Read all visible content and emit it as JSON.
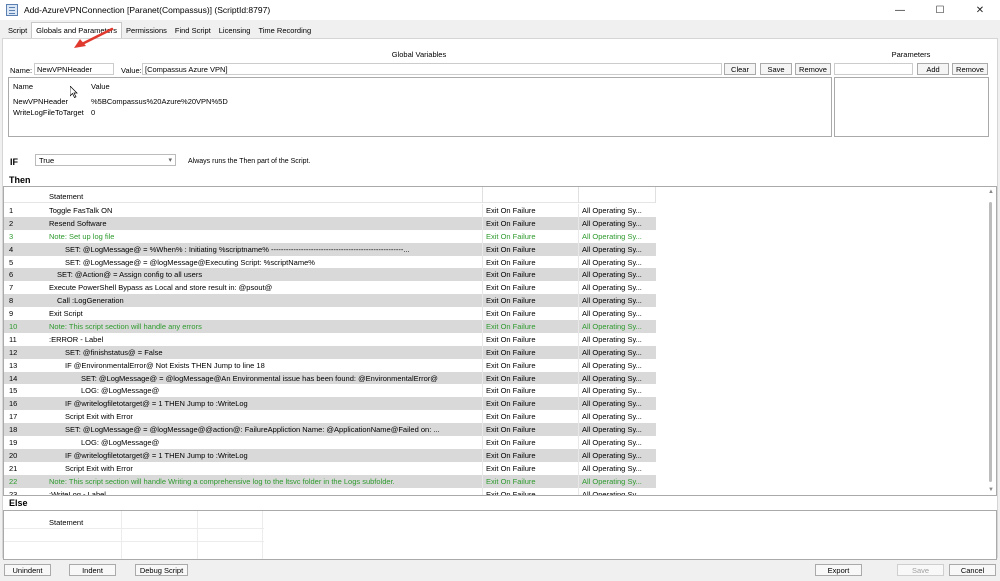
{
  "window": {
    "title": "Add-AzureVPNConnection [Paranet(Compassus)]    (ScriptId:8797)",
    "minimize_glyph": "—",
    "maximize_glyph": "☐",
    "close_glyph": "✕"
  },
  "tabs": [
    {
      "label": "Script"
    },
    {
      "label": "Globals and Parameters"
    },
    {
      "label": "Permissions"
    },
    {
      "label": "Find Script"
    },
    {
      "label": "Licensing"
    },
    {
      "label": "Time Recording"
    }
  ],
  "globals": {
    "section_title": "Global Variables",
    "name_label": "Name:",
    "name_value": "NewVPNHeader",
    "value_label": "Value:",
    "value_value": "[Compassus Azure VPN]",
    "clear_label": "Clear",
    "save_label": "Save",
    "remove_label": "Remove",
    "table": {
      "headers": [
        "Name",
        "Value"
      ],
      "rows": [
        {
          "name": "NewVPNHeader",
          "value": "%5BCompassus%20Azure%20VPN%5D"
        },
        {
          "name": "WriteLogFileToTarget",
          "value": "0"
        }
      ]
    }
  },
  "parameters": {
    "section_title": "Parameters",
    "add_label": "Add",
    "remove_label": "Remove"
  },
  "if_section": {
    "label": "IF",
    "selected": "True",
    "hint": "Always runs the Then part of the Script."
  },
  "then_section": {
    "label": "Then",
    "header": "Statement",
    "rows": [
      {
        "num": "1",
        "indent": 0,
        "text": "Toggle FasTalk ON",
        "fail": "Exit On Failure",
        "os": "All Operating Sy...",
        "shade": false,
        "note": false
      },
      {
        "num": "2",
        "indent": 0,
        "text": "Resend Software",
        "fail": "Exit On Failure",
        "os": "All Operating Sy...",
        "shade": true,
        "note": false
      },
      {
        "num": "3",
        "indent": 0,
        "text": "Note: Set up log file",
        "fail": "Exit On Failure",
        "os": "All Operating Sy...",
        "shade": false,
        "note": true
      },
      {
        "num": "4",
        "indent": 2,
        "text": "SET:  @LogMessage@ = %When% : Initiating %scriptname% -----------------------------------------------------...",
        "fail": "Exit On Failure",
        "os": "All Operating Sy...",
        "shade": true,
        "note": false
      },
      {
        "num": "5",
        "indent": 2,
        "text": "SET:  @LogMessage@ = @logMessage@Executing Script: %scriptName%",
        "fail": "Exit On Failure",
        "os": "All Operating Sy...",
        "shade": false,
        "note": false
      },
      {
        "num": "6",
        "indent": 1,
        "text": "SET:  @Action@ = Assign config to all users",
        "fail": "Exit On Failure",
        "os": "All Operating Sy...",
        "shade": true,
        "note": false
      },
      {
        "num": "7",
        "indent": 0,
        "text": "Execute PowerShell Bypass as Local and store result in: @psout@",
        "fail": "Exit On Failure",
        "os": "All Operating Sy...",
        "shade": false,
        "note": false
      },
      {
        "num": "8",
        "indent": 1,
        "text": "Call :LogGeneration",
        "fail": "Exit On Failure",
        "os": "All Operating Sy...",
        "shade": true,
        "note": false
      },
      {
        "num": "9",
        "indent": 0,
        "text": "Exit Script",
        "fail": "Exit On Failure",
        "os": "All Operating Sy...",
        "shade": false,
        "note": false
      },
      {
        "num": "10",
        "indent": 0,
        "text": "Note: This script section will handle any errors",
        "fail": "Exit On Failure",
        "os": "All Operating Sy...",
        "shade": true,
        "note": true
      },
      {
        "num": "11",
        "indent": 0,
        "text": ":ERROR - Label",
        "fail": "Exit On Failure",
        "os": "All Operating Sy...",
        "shade": false,
        "note": false
      },
      {
        "num": "12",
        "indent": 2,
        "text": "SET:  @finishstatus@ = False",
        "fail": "Exit On Failure",
        "os": "All Operating Sy...",
        "shade": true,
        "note": false
      },
      {
        "num": "13",
        "indent": 2,
        "text": "IF  @EnvironmentalError@  Not Exists    THEN  Jump to line 18",
        "fail": "Exit On Failure",
        "os": "All Operating Sy...",
        "shade": false,
        "note": false
      },
      {
        "num": "14",
        "indent": 4,
        "text": "SET:  @LogMessage@ = @logMessage@An Environmental issue has been found:  @EnvironmentalError@",
        "fail": "Exit On Failure",
        "os": "All Operating Sy...",
        "shade": true,
        "note": false
      },
      {
        "num": "15",
        "indent": 4,
        "text": "LOG:  @LogMessage@",
        "fail": "Exit On Failure",
        "os": "All Operating Sy...",
        "shade": false,
        "note": false
      },
      {
        "num": "16",
        "indent": 2,
        "text": "IF  @writelogfiletotarget@  =  1  THEN  Jump to :WriteLog",
        "fail": "Exit On Failure",
        "os": "All Operating Sy...",
        "shade": true,
        "note": false
      },
      {
        "num": "17",
        "indent": 2,
        "text": "Script Exit with Error",
        "fail": "Exit On Failure",
        "os": "All Operating Sy...",
        "shade": false,
        "note": false
      },
      {
        "num": "18",
        "indent": 2,
        "text": "SET:  @LogMessage@ = @logMessage@@action@: FailureAppliction Name: @ApplicationName@Failed on: ...",
        "fail": "Exit On Failure",
        "os": "All Operating Sy...",
        "shade": true,
        "note": false
      },
      {
        "num": "19",
        "indent": 4,
        "text": "LOG:  @LogMessage@",
        "fail": "Exit On Failure",
        "os": "All Operating Sy...",
        "shade": false,
        "note": false
      },
      {
        "num": "20",
        "indent": 2,
        "text": "IF  @writelogfiletotarget@  =  1  THEN  Jump to :WriteLog",
        "fail": "Exit On Failure",
        "os": "All Operating Sy...",
        "shade": true,
        "note": false
      },
      {
        "num": "21",
        "indent": 2,
        "text": "Script Exit with Error",
        "fail": "Exit On Failure",
        "os": "All Operating Sy...",
        "shade": false,
        "note": false
      },
      {
        "num": "22",
        "indent": 0,
        "text": "Note: This script section will handle Writing a comprehensive log to the ltsvc folder in the Logs subfolder.",
        "fail": "Exit On Failure",
        "os": "All Operating Sy...",
        "shade": true,
        "note": true
      },
      {
        "num": "23",
        "indent": 0,
        "text": ":WriteLog - Label",
        "fail": "Exit On Failure",
        "os": "All Operating Sy...",
        "shade": false,
        "note": false
      }
    ]
  },
  "else_section": {
    "label": "Else",
    "header": "Statement"
  },
  "bottom": {
    "unindent_label": "Unindent",
    "indent_label": "Indent",
    "debug_label": "Debug Script",
    "export_label": "Export",
    "save_label": "Save",
    "cancel_label": "Cancel"
  },
  "colors": {
    "note_green": "#2e9a2e",
    "row_shade": "#d9d9d9",
    "annotation_arrow": "#e03a2f"
  }
}
